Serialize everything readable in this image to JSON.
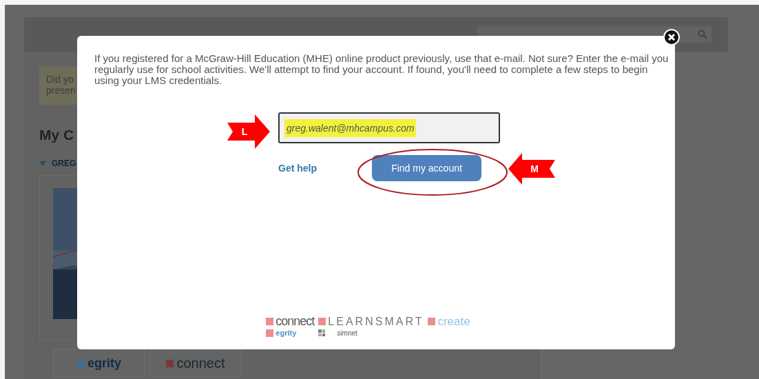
{
  "background": {
    "notice": [
      "Did yo",
      "presen"
    ],
    "heading": "My C",
    "section": {
      "label": "GREG",
      "expanded": true
    },
    "product_tabs": [
      {
        "label": "egrity"
      },
      {
        "label": "connect"
      }
    ]
  },
  "dialog": {
    "message": "If you registered for a McGraw-Hill Education (MHE) online product previously, use that e-mail. Not sure? Enter the e-mail you regularly use for school activities. We'll attempt to find your account. If found, you'll need to complete a few steps to begin using your LMS credentials.",
    "email": {
      "value": "greg.walent@mhcampus.com",
      "highlighted": true
    },
    "help_link": "Get help",
    "submit": "Find my account",
    "callouts": [
      {
        "label": "L"
      },
      {
        "label": "M"
      }
    ],
    "brands": [
      "connect",
      "LEARNSMART",
      "create",
      "egrity",
      "simnet"
    ]
  }
}
